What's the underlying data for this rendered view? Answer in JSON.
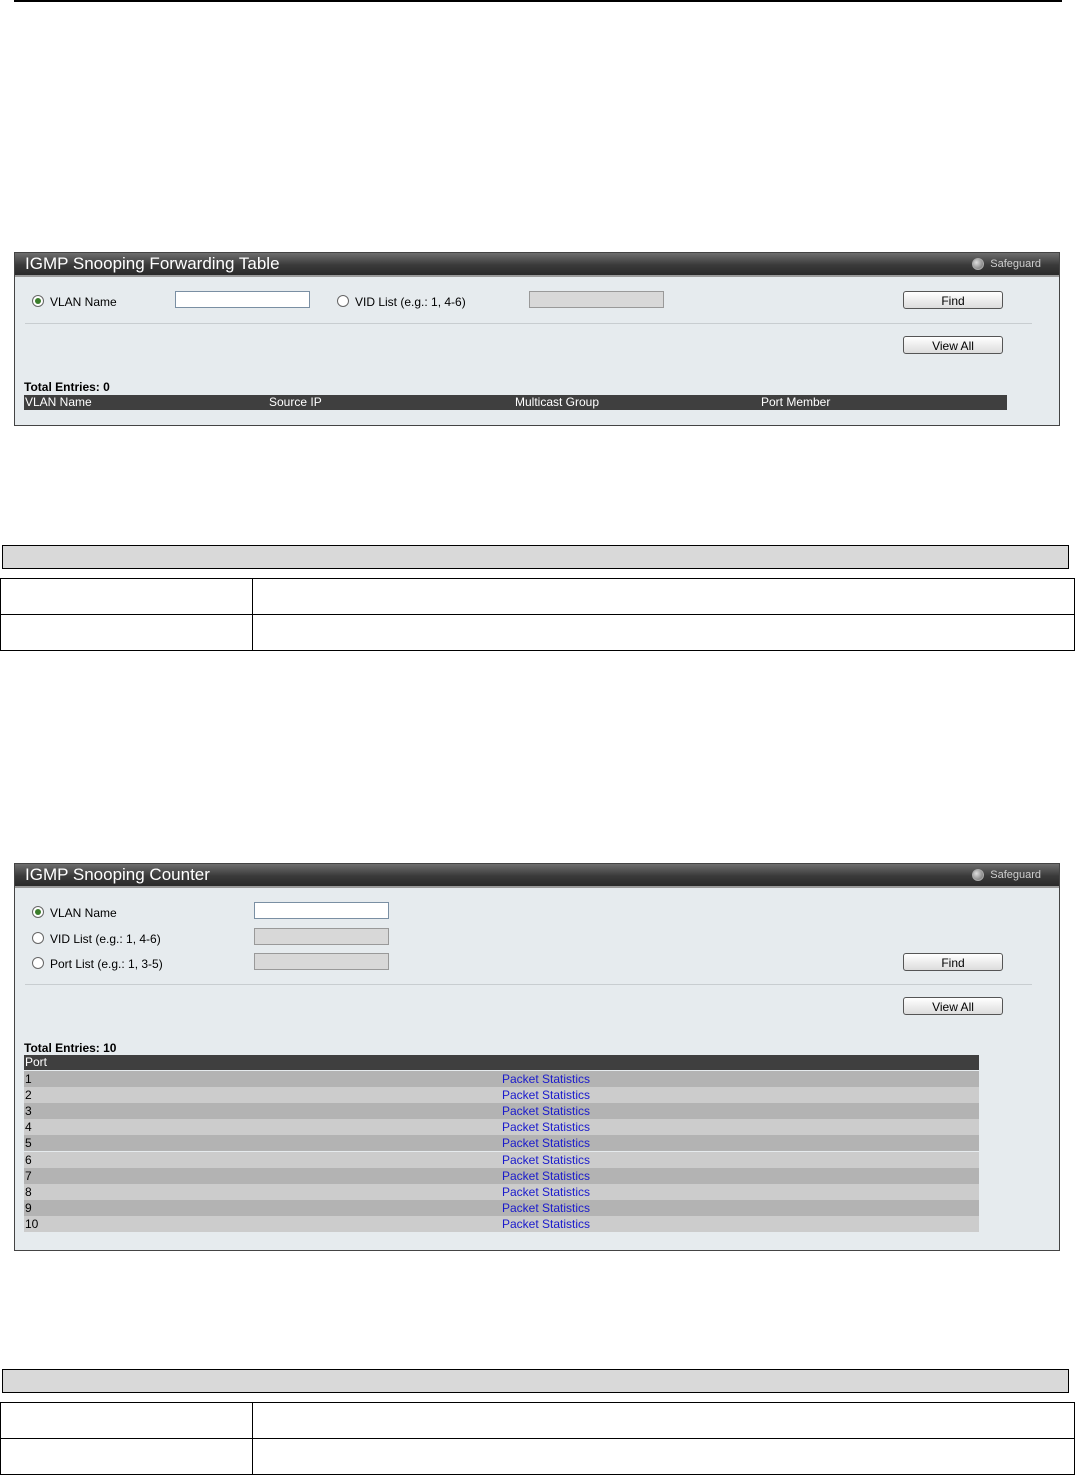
{
  "forwarding_panel": {
    "title": "IGMP Snooping Forwarding Table",
    "safeguard": "Safeguard",
    "vlan_name_label": "VLAN Name",
    "vlan_name_value": "",
    "vid_list_label": "VID List (e.g.: 1, 4-6)",
    "vid_list_value": "",
    "find_label": "Find",
    "view_all_label": "View All",
    "total_entries": "Total Entries: 0",
    "columns": [
      "VLAN Name",
      "Source IP",
      "Multicast Group",
      "Port Member"
    ]
  },
  "counter_panel": {
    "title": "IGMP Snooping Counter",
    "safeguard": "Safeguard",
    "vlan_name_label": "VLAN Name",
    "vlan_name_value": "",
    "vid_list_label": "VID List (e.g.: 1, 4-6)",
    "vid_list_value": "",
    "port_list_label": "Port List (e.g.: 1, 3-5)",
    "port_list_value": "",
    "find_label": "Find",
    "view_all_label": "View All",
    "total_entries": "Total Entries: 10",
    "column_port": "Port",
    "rows": [
      {
        "port": "1",
        "link": "Packet Statistics"
      },
      {
        "port": "2",
        "link": "Packet Statistics"
      },
      {
        "port": "3",
        "link": "Packet Statistics"
      },
      {
        "port": "4",
        "link": "Packet Statistics"
      },
      {
        "port": "5",
        "link": "Packet Statistics"
      },
      {
        "port": "6",
        "link": "Packet Statistics"
      },
      {
        "port": "7",
        "link": "Packet Statistics"
      },
      {
        "port": "8",
        "link": "Packet Statistics"
      },
      {
        "port": "9",
        "link": "Packet Statistics"
      },
      {
        "port": "10",
        "link": "Packet Statistics"
      }
    ]
  },
  "colors": {
    "panel_bg": "#e6ebee",
    "header_dark": "#3a3a3a",
    "row_odd": "#b3b3b3",
    "row_even": "#cccccc",
    "link": "#1a1acc",
    "radio_checked": "#3a7d2a"
  }
}
